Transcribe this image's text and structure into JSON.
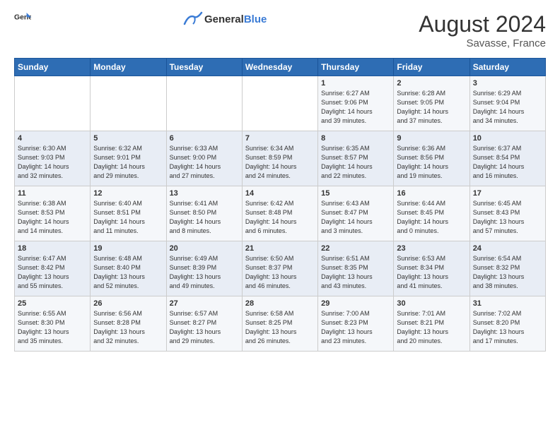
{
  "header": {
    "logo_general": "General",
    "logo_blue": "Blue",
    "month_year": "August 2024",
    "location": "Savasse, France"
  },
  "days_of_week": [
    "Sunday",
    "Monday",
    "Tuesday",
    "Wednesday",
    "Thursday",
    "Friday",
    "Saturday"
  ],
  "weeks": [
    [
      {
        "day": "",
        "info": ""
      },
      {
        "day": "",
        "info": ""
      },
      {
        "day": "",
        "info": ""
      },
      {
        "day": "",
        "info": ""
      },
      {
        "day": "1",
        "info": "Sunrise: 6:27 AM\nSunset: 9:06 PM\nDaylight: 14 hours\nand 39 minutes."
      },
      {
        "day": "2",
        "info": "Sunrise: 6:28 AM\nSunset: 9:05 PM\nDaylight: 14 hours\nand 37 minutes."
      },
      {
        "day": "3",
        "info": "Sunrise: 6:29 AM\nSunset: 9:04 PM\nDaylight: 14 hours\nand 34 minutes."
      }
    ],
    [
      {
        "day": "4",
        "info": "Sunrise: 6:30 AM\nSunset: 9:03 PM\nDaylight: 14 hours\nand 32 minutes."
      },
      {
        "day": "5",
        "info": "Sunrise: 6:32 AM\nSunset: 9:01 PM\nDaylight: 14 hours\nand 29 minutes."
      },
      {
        "day": "6",
        "info": "Sunrise: 6:33 AM\nSunset: 9:00 PM\nDaylight: 14 hours\nand 27 minutes."
      },
      {
        "day": "7",
        "info": "Sunrise: 6:34 AM\nSunset: 8:59 PM\nDaylight: 14 hours\nand 24 minutes."
      },
      {
        "day": "8",
        "info": "Sunrise: 6:35 AM\nSunset: 8:57 PM\nDaylight: 14 hours\nand 22 minutes."
      },
      {
        "day": "9",
        "info": "Sunrise: 6:36 AM\nSunset: 8:56 PM\nDaylight: 14 hours\nand 19 minutes."
      },
      {
        "day": "10",
        "info": "Sunrise: 6:37 AM\nSunset: 8:54 PM\nDaylight: 14 hours\nand 16 minutes."
      }
    ],
    [
      {
        "day": "11",
        "info": "Sunrise: 6:38 AM\nSunset: 8:53 PM\nDaylight: 14 hours\nand 14 minutes."
      },
      {
        "day": "12",
        "info": "Sunrise: 6:40 AM\nSunset: 8:51 PM\nDaylight: 14 hours\nand 11 minutes."
      },
      {
        "day": "13",
        "info": "Sunrise: 6:41 AM\nSunset: 8:50 PM\nDaylight: 14 hours\nand 8 minutes."
      },
      {
        "day": "14",
        "info": "Sunrise: 6:42 AM\nSunset: 8:48 PM\nDaylight: 14 hours\nand 6 minutes."
      },
      {
        "day": "15",
        "info": "Sunrise: 6:43 AM\nSunset: 8:47 PM\nDaylight: 14 hours\nand 3 minutes."
      },
      {
        "day": "16",
        "info": "Sunrise: 6:44 AM\nSunset: 8:45 PM\nDaylight: 14 hours\nand 0 minutes."
      },
      {
        "day": "17",
        "info": "Sunrise: 6:45 AM\nSunset: 8:43 PM\nDaylight: 13 hours\nand 57 minutes."
      }
    ],
    [
      {
        "day": "18",
        "info": "Sunrise: 6:47 AM\nSunset: 8:42 PM\nDaylight: 13 hours\nand 55 minutes."
      },
      {
        "day": "19",
        "info": "Sunrise: 6:48 AM\nSunset: 8:40 PM\nDaylight: 13 hours\nand 52 minutes."
      },
      {
        "day": "20",
        "info": "Sunrise: 6:49 AM\nSunset: 8:39 PM\nDaylight: 13 hours\nand 49 minutes."
      },
      {
        "day": "21",
        "info": "Sunrise: 6:50 AM\nSunset: 8:37 PM\nDaylight: 13 hours\nand 46 minutes."
      },
      {
        "day": "22",
        "info": "Sunrise: 6:51 AM\nSunset: 8:35 PM\nDaylight: 13 hours\nand 43 minutes."
      },
      {
        "day": "23",
        "info": "Sunrise: 6:53 AM\nSunset: 8:34 PM\nDaylight: 13 hours\nand 41 minutes."
      },
      {
        "day": "24",
        "info": "Sunrise: 6:54 AM\nSunset: 8:32 PM\nDaylight: 13 hours\nand 38 minutes."
      }
    ],
    [
      {
        "day": "25",
        "info": "Sunrise: 6:55 AM\nSunset: 8:30 PM\nDaylight: 13 hours\nand 35 minutes."
      },
      {
        "day": "26",
        "info": "Sunrise: 6:56 AM\nSunset: 8:28 PM\nDaylight: 13 hours\nand 32 minutes."
      },
      {
        "day": "27",
        "info": "Sunrise: 6:57 AM\nSunset: 8:27 PM\nDaylight: 13 hours\nand 29 minutes."
      },
      {
        "day": "28",
        "info": "Sunrise: 6:58 AM\nSunset: 8:25 PM\nDaylight: 13 hours\nand 26 minutes."
      },
      {
        "day": "29",
        "info": "Sunrise: 7:00 AM\nSunset: 8:23 PM\nDaylight: 13 hours\nand 23 minutes."
      },
      {
        "day": "30",
        "info": "Sunrise: 7:01 AM\nSunset: 8:21 PM\nDaylight: 13 hours\nand 20 minutes."
      },
      {
        "day": "31",
        "info": "Sunrise: 7:02 AM\nSunset: 8:20 PM\nDaylight: 13 hours\nand 17 minutes."
      }
    ]
  ]
}
